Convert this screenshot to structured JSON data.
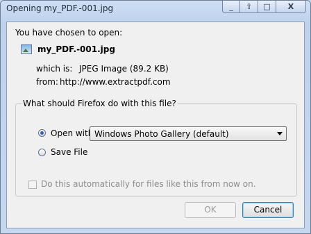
{
  "window": {
    "title": "Opening my_PDF.-001.jpg",
    "buttons": {
      "minimize": "_",
      "unknown": "⇧",
      "maximize": "□",
      "close": "X"
    }
  },
  "header": {
    "chosen_text": "You have chosen to open:",
    "file_name": "my_PDF.-001.jpg",
    "which_is_label": "which is:",
    "which_is_value": "JPEG Image (89.2 KB)",
    "from_label": "from:",
    "from_value": "http://www.extractpdf.com"
  },
  "group": {
    "legend": "What should Firefox do with this file?",
    "open_with_label": "Open with",
    "open_with_selected": true,
    "application": "Windows Photo Gallery (default)",
    "save_file_label": "Save File",
    "save_file_selected": false,
    "auto_label": "Do this automatically for files like this from now on.",
    "auto_checked": false
  },
  "footer": {
    "ok_label": "OK",
    "cancel_label": "Cancel"
  }
}
